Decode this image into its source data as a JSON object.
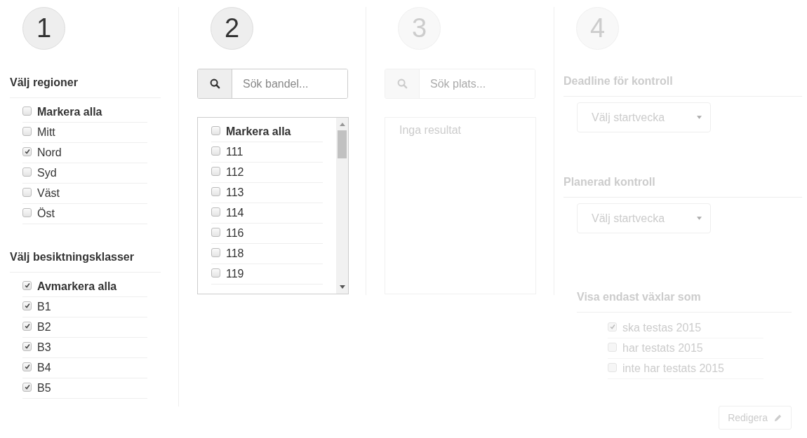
{
  "columns": [
    {
      "kind": "checklists",
      "step": "1",
      "disabled": false,
      "groups": [
        {
          "title": "Välj regioner",
          "items": [
            {
              "kind": "all",
              "label": "Markera alla",
              "checked": false
            },
            {
              "kind": "item",
              "label": "Mitt",
              "checked": false
            },
            {
              "kind": "item",
              "label": "Nord",
              "checked": true
            },
            {
              "kind": "item",
              "label": "Syd",
              "checked": false
            },
            {
              "kind": "item",
              "label": "Väst",
              "checked": false
            },
            {
              "kind": "item",
              "label": "Öst",
              "checked": false
            }
          ]
        },
        {
          "title": "Välj besiktningsklasser",
          "items": [
            {
              "kind": "all",
              "label": "Avmarkera alla",
              "checked": true
            },
            {
              "kind": "item",
              "label": "B1",
              "checked": true
            },
            {
              "kind": "item",
              "label": "B2",
              "checked": true
            },
            {
              "kind": "item",
              "label": "B3",
              "checked": true
            },
            {
              "kind": "item",
              "label": "B4",
              "checked": true
            },
            {
              "kind": "item",
              "label": "B5",
              "checked": true
            }
          ]
        }
      ]
    },
    {
      "kind": "search-list",
      "step": "2",
      "disabled": false,
      "search_placeholder": "Sök bandel...",
      "items": [
        {
          "kind": "all",
          "label": "Markera alla",
          "checked": false
        },
        {
          "kind": "item",
          "label": "111",
          "checked": false
        },
        {
          "kind": "item",
          "label": "112",
          "checked": false
        },
        {
          "kind": "item",
          "label": "113",
          "checked": false
        },
        {
          "kind": "item",
          "label": "114",
          "checked": false
        },
        {
          "kind": "item",
          "label": "116",
          "checked": false
        },
        {
          "kind": "item",
          "label": "118",
          "checked": false
        },
        {
          "kind": "item",
          "label": "119",
          "checked": false
        }
      ]
    },
    {
      "kind": "search-results",
      "step": "3",
      "disabled": true,
      "search_placeholder": "Sök plats...",
      "empty_text": "Inga resultat"
    },
    {
      "kind": "planning",
      "step": "4",
      "disabled": true,
      "fields": [
        {
          "title": "Deadline för kontroll",
          "placeholder": "Välj startvecka"
        },
        {
          "title": "Planerad kontroll",
          "placeholder": "Välj startvecka"
        }
      ],
      "filter": {
        "title": "Visa endast växlar som",
        "items": [
          {
            "label": "ska testas 2015",
            "checked": true
          },
          {
            "label": "har testats 2015",
            "checked": false
          },
          {
            "label": "inte har testats 2015",
            "checked": false
          }
        ]
      },
      "button": "Redigera"
    }
  ]
}
